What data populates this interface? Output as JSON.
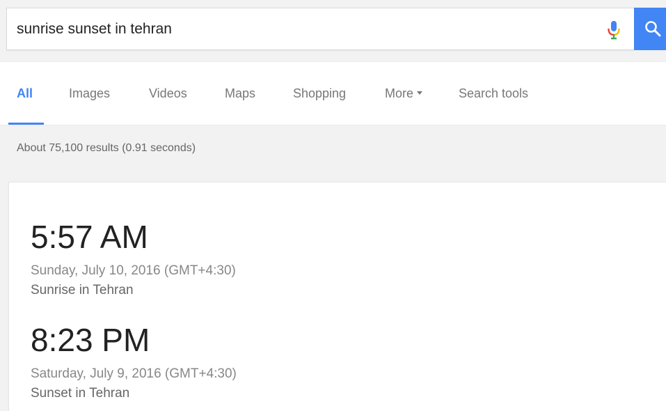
{
  "search": {
    "query": "sunrise sunset in tehran"
  },
  "icons": {
    "mic": "microphone-icon",
    "search": "search-icon",
    "caret": "caret-down-icon"
  },
  "colors": {
    "accent": "#4285f4",
    "mic_blue": "#4285f4",
    "mic_red": "#ea4335",
    "mic_yellow": "#fbbc05",
    "mic_green": "#34a853"
  },
  "tabs": [
    {
      "label": "All",
      "active": true
    },
    {
      "label": "Images",
      "active": false
    },
    {
      "label": "Videos",
      "active": false
    },
    {
      "label": "Maps",
      "active": false
    },
    {
      "label": "Shopping",
      "active": false
    },
    {
      "label": "More",
      "active": false
    },
    {
      "label": "Search tools",
      "active": false
    }
  ],
  "stats": "About 75,100 results (0.91 seconds)",
  "answer": {
    "sunrise": {
      "time": "5:57 AM",
      "date": "Sunday, July 10, 2016 (GMT+4:30)",
      "label": "Sunrise in Tehran"
    },
    "sunset": {
      "time": "8:23 PM",
      "date": "Saturday, July 9, 2016 (GMT+4:30)",
      "label": "Sunset in Tehran"
    }
  }
}
